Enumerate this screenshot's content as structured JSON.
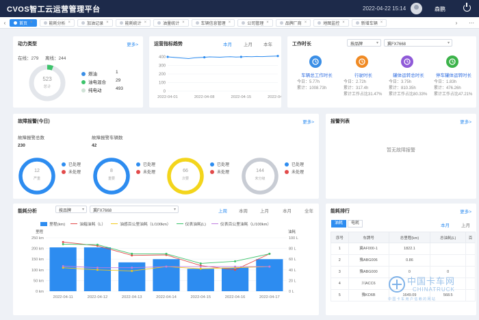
{
  "header": {
    "title": "CVOS智工云运营管理平台",
    "datetime": "2022-04-22 15:14",
    "user": "森鹏"
  },
  "tabs": [
    {
      "label": "首页",
      "active": true
    },
    {
      "label": "能耗分析",
      "active": false
    },
    {
      "label": "加油记录",
      "active": false
    },
    {
      "label": "能耗统计",
      "active": false
    },
    {
      "label": "油量统计",
      "active": false
    },
    {
      "label": "车辆信息管理",
      "active": false
    },
    {
      "label": "公司管理",
      "active": false
    },
    {
      "label": "品牌厂商",
      "active": false
    },
    {
      "label": "地图监控",
      "active": false
    },
    {
      "label": "新增车辆",
      "active": false
    }
  ],
  "power": {
    "title": "动力类型",
    "more": "更多>",
    "online_label": "在线：279",
    "offline_label": "离线：244",
    "center_value": "523",
    "center_label": "总计",
    "items": [
      {
        "label": "燃油",
        "value": "1",
        "color": "#3a8ee6"
      },
      {
        "label": "油电混合",
        "value": "29",
        "color": "#3cc36b"
      },
      {
        "label": "纯电动",
        "value": "493",
        "color": "#cfe2d6"
      }
    ]
  },
  "ops": {
    "title": "运营指标趋势",
    "periods": [
      "本月",
      "上月",
      "本年"
    ],
    "chart_data": {
      "type": "line",
      "x": [
        "2022-04-01",
        "2022-04-02",
        "2022-04-03",
        "2022-04-04",
        "2022-04-05",
        "2022-04-06",
        "2022-04-07",
        "2022-04-08",
        "2022-04-09",
        "2022-04-10",
        "2022-04-11",
        "2022-04-12",
        "2022-04-13",
        "2022-04-14",
        "2022-04-15",
        "2022-04-16",
        "2022-04-17",
        "2022-04-18",
        "2022-04-19",
        "2022-04-20",
        "2022-04-21",
        "2022-04-22"
      ],
      "xticks": [
        "2022-04-01",
        "2022-04-08",
        "2022-04-15",
        "2022-04-22"
      ],
      "values": [
        400,
        395,
        390,
        385,
        380,
        388,
        392,
        395,
        400,
        398,
        396,
        400,
        402,
        398,
        400,
        404,
        402,
        405,
        403,
        406,
        408,
        410
      ],
      "yticks": [
        "400",
        "300",
        "200",
        "100",
        "0"
      ],
      "ylim": [
        0,
        400
      ]
    }
  },
  "worktime": {
    "title": "工作时长",
    "select1": "按品牌",
    "select2": "冀FX7668",
    "items": [
      {
        "label": "车辆总工作时长",
        "color": "#3a8ee6",
        "lines": [
          "今日：5.77h",
          "累计：1008.73h"
        ]
      },
      {
        "label": "行驶时长",
        "color": "#f08a24",
        "lines": [
          "今日：2.72h",
          "累计：317.4h",
          "累计工作占比31.47%"
        ]
      },
      {
        "label": "罐体运转总时长",
        "color": "#8f5ad8",
        "lines": [
          "今日：3.75h",
          "累计：810.35h",
          "累计工作占比80.33%"
        ]
      },
      {
        "label": "停车罐体运转时长",
        "color": "#3cb34a",
        "lines": [
          "今日：1.83h",
          "累计：476.26h",
          "累计工作占比47.21%"
        ]
      }
    ]
  },
  "fault": {
    "title": "故障报警(今日)",
    "more": "更多>",
    "total_label": "故障报警总数",
    "total_value": "230",
    "vehicles_label": "故障报警车辆数",
    "vehicles_value": "42",
    "handled_label": "已处理",
    "unhandled_label": "未处理",
    "rings": [
      {
        "value": "12",
        "label": "严重",
        "color": "#2d8cf0"
      },
      {
        "value": "8",
        "label": "重要",
        "color": "#2d8cf0"
      },
      {
        "value": "66",
        "label": "次要",
        "color": "#f3d51c"
      },
      {
        "value": "144",
        "label": "未分级",
        "color": "#c8ccd4"
      }
    ]
  },
  "alarm": {
    "title": "报警列表",
    "more": "更多>",
    "empty": "暂无故障报警"
  },
  "energy": {
    "title": "能耗分析",
    "select1": "按品牌",
    "select2": "冀FX7668",
    "periods": [
      "上周",
      "本周",
      "上月",
      "本月",
      "全年"
    ],
    "chart_data": {
      "type": "bar",
      "categories": [
        "2022-04-11",
        "2022-04-12",
        "2022-04-13",
        "2022-04-14",
        "2022-04-15",
        "2022-04-16",
        "2022-04-17"
      ],
      "left_label": "里程",
      "right_label": "油耗",
      "series": [
        {
          "name": "里程(km)",
          "type": "bar",
          "color": "#2d8cf0",
          "values": [
            205,
            205,
            135,
            150,
            105,
            110,
            150
          ]
        },
        {
          "name": "油箱油耗（L）",
          "type": "line",
          "color": "#e24a4a",
          "values": [
            92,
            85,
            67,
            68,
            48,
            40,
            70
          ]
        },
        {
          "name": "油感百公里油耗（L/100km）",
          "type": "line",
          "color": "#f3c819",
          "values": [
            44,
            40,
            38,
            46,
            42,
            44,
            46
          ]
        },
        {
          "name": "仪表油耗(L)",
          "type": "line",
          "color": "#3cc36b",
          "values": [
            88,
            87,
            70,
            70,
            52,
            56,
            70
          ]
        },
        {
          "name": "仪表百公里油耗（L/100km）",
          "type": "line",
          "color": "#c07ce0",
          "values": [
            47,
            44,
            44,
            46,
            46,
            46,
            46
          ]
        }
      ],
      "ylim_left": [
        0,
        250
      ],
      "yticks_left": [
        "250 km",
        "200 km",
        "150 km",
        "100 km",
        "50 km",
        "0 km"
      ],
      "ylim_right": [
        0,
        100
      ],
      "yticks_right": [
        "100 L",
        "80 L",
        "60 L",
        "40 L",
        "20 L",
        "0 L"
      ]
    }
  },
  "rank": {
    "title": "能耗排行",
    "more": "更多>",
    "tabs": [
      "油耗",
      "电耗"
    ],
    "periods": [
      "本月",
      "上月"
    ],
    "columns": [
      "序号",
      "车牌号",
      "总里程(km)",
      "总油耗(L)",
      "百"
    ],
    "rows": [
      [
        "1",
        "冀AF000-1",
        "1822.1",
        "",
        ""
      ],
      [
        "2",
        "豫ABG006",
        "0.86",
        "",
        ""
      ],
      [
        "3",
        "豫ABG000",
        "0",
        "0",
        ""
      ],
      [
        "4",
        "川ACC6",
        "",
        "",
        ""
      ],
      [
        "5",
        "豫KD6B",
        "1649.09",
        "568.5",
        ""
      ]
    ]
  },
  "watermark": {
    "cn": "中国卡车网",
    "en": "CHINATRUCK",
    "sub": "中 国 卡 车 用 户 信 赖 的 网 站"
  },
  "colors": {
    "accent": "#2d8cf0",
    "header": "#1d2a4a"
  }
}
